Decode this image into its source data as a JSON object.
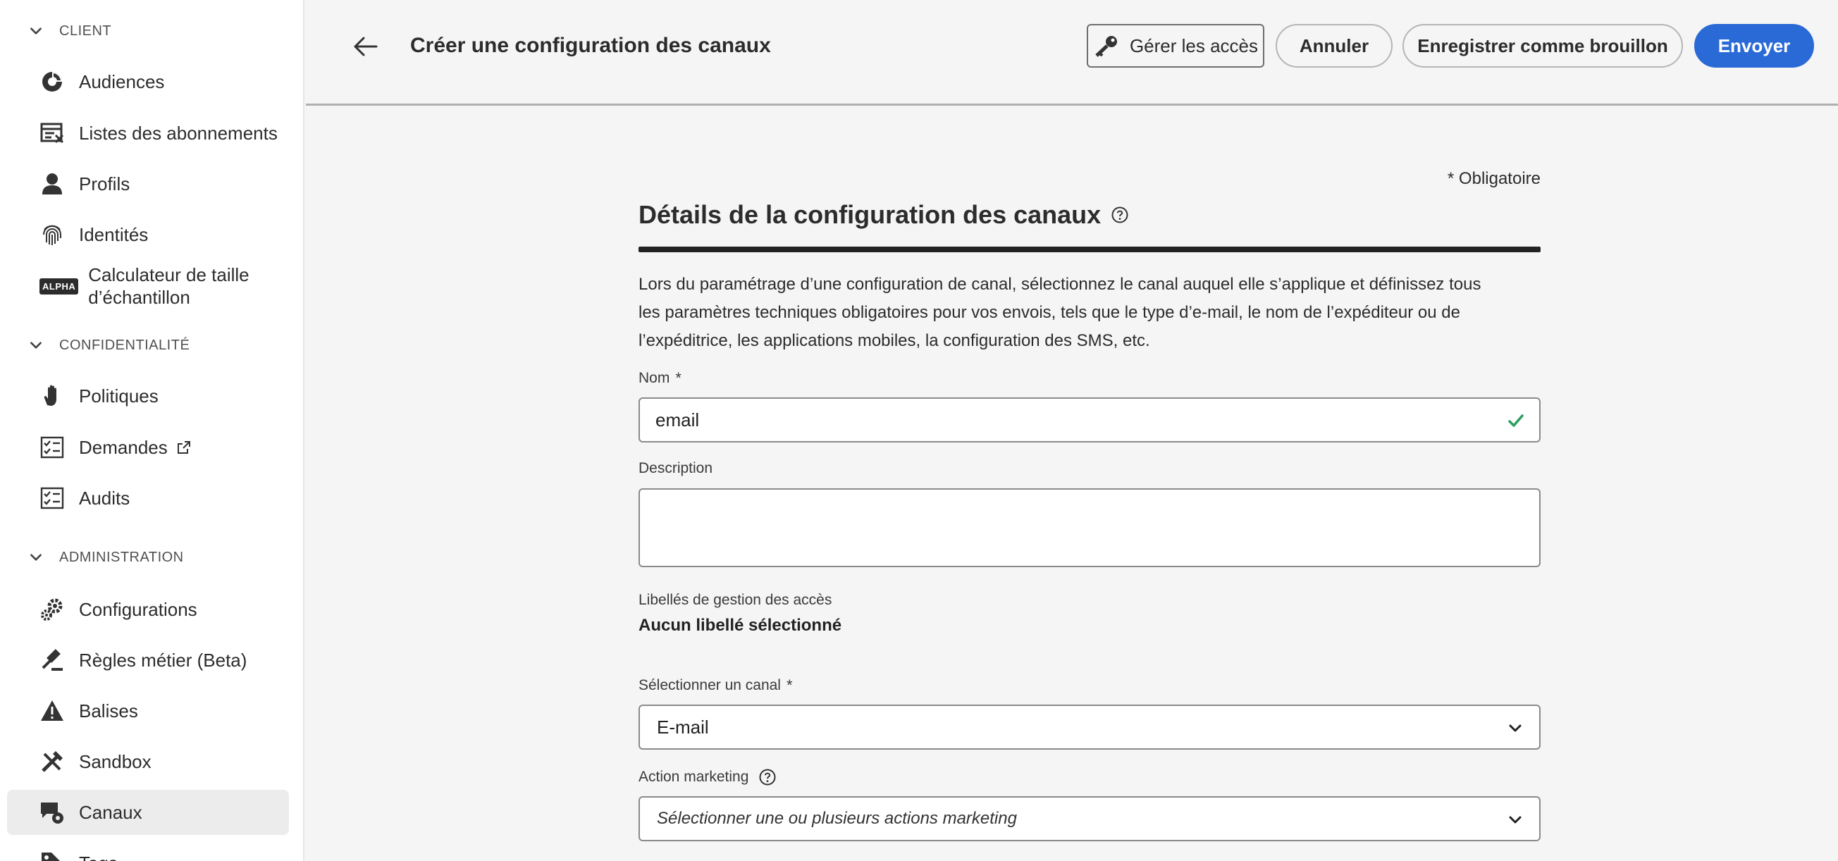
{
  "sidebar": {
    "sections": [
      {
        "title": "CLIENT"
      },
      {
        "title": "CONFIDENTIALITÉ"
      },
      {
        "title": "ADMINISTRATION"
      }
    ],
    "items": [
      {
        "label": "Audiences",
        "icon": "audiences-icon"
      },
      {
        "label": "Listes des abonnements",
        "icon": "subscription-list-icon"
      },
      {
        "label": "Profils",
        "icon": "profile-icon"
      },
      {
        "label": "Identités",
        "icon": "fingerprint-icon"
      },
      {
        "label": "Calculateur de taille d’échantillon",
        "badge": "ALPHA"
      },
      {
        "label": "Politiques",
        "icon": "hand-icon"
      },
      {
        "label": "Demandes",
        "icon": "checklist-icon"
      },
      {
        "label": "Audits",
        "icon": "checklist-icon"
      },
      {
        "label": "Configurations",
        "icon": "gears-icon"
      },
      {
        "label": "Règles métier (Beta)",
        "icon": "gavel-icon"
      },
      {
        "label": "Balises",
        "icon": "alert-icon"
      },
      {
        "label": "Sandbox",
        "icon": "tools-icon"
      },
      {
        "label": "Canaux",
        "icon": "channels-icon",
        "active": true
      },
      {
        "label": "Tags",
        "icon": "tag-icon"
      }
    ]
  },
  "header": {
    "title": "Créer une configuration des canaux",
    "manage_access": "Gérer les accès",
    "cancel": "Annuler",
    "save_draft": "Enregistrer comme brouillon",
    "send": "Envoyer"
  },
  "form": {
    "required_note": "* Obligatoire",
    "title": "Détails de la configuration des canaux",
    "intro": "Lors du paramétrage d’une configuration de canal, sélectionnez le canal auquel elle s’applique et définissez tous les paramètres techniques obligatoires pour vos envois, tels que le type d’e-mail, le nom de l’expéditeur ou de l’expéditrice, les applications mobiles, la configuration des SMS, etc.",
    "name_label": "Nom",
    "required_mark": "*",
    "name_value": "email",
    "description_label": "Description",
    "description_value": "",
    "access_labels_label": "Libellés de gestion des accès",
    "access_labels_value": "Aucun libellé sélectionné",
    "channel_label": "Sélectionner un canal",
    "channel_value": "E-mail",
    "marketing_label": "Action marketing",
    "marketing_placeholder": "Sélectionner une ou plusieurs actions marketing"
  },
  "colors": {
    "accent": "#2a6ad6",
    "valid": "#2d9d5e"
  }
}
